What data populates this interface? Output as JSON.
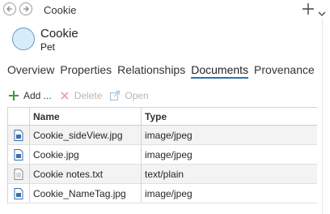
{
  "window": {
    "title": "Cookie",
    "back_icon": "back-arrow-icon",
    "forward_icon": "forward-arrow-icon",
    "add_icon": "plus-icon",
    "menu_icon": "chevron-down-icon"
  },
  "entity": {
    "name": "Cookie",
    "type": "Pet",
    "icon_fill": "#d7ecfa",
    "icon_stroke": "#6a98c4"
  },
  "tabs": [
    {
      "label": "Overview",
      "active": false
    },
    {
      "label": "Properties",
      "active": false
    },
    {
      "label": "Relationships",
      "active": false
    },
    {
      "label": "Documents",
      "active": true
    },
    {
      "label": "Provenance",
      "active": false
    }
  ],
  "toolbar": {
    "add_label": "Add ...",
    "delete_label": "Delete",
    "open_label": "Open"
  },
  "table": {
    "headers": {
      "name": "Name",
      "type": "Type"
    },
    "rows": [
      {
        "name": "Cookie_sideView.jpg",
        "type": "image/jpeg",
        "icon": "image-file-icon"
      },
      {
        "name": "Cookie.jpg",
        "type": "image/jpeg",
        "icon": "image-file-icon"
      },
      {
        "name": "Cookie notes.txt",
        "type": "text/plain",
        "icon": "text-file-icon"
      },
      {
        "name": "Cookie_NameTag.jpg",
        "type": "image/jpeg",
        "icon": "image-file-icon"
      }
    ]
  },
  "colors": {
    "accent": "#2a72b5",
    "add_green": "#3c9a3c",
    "disabled": "#b5b5b5"
  }
}
